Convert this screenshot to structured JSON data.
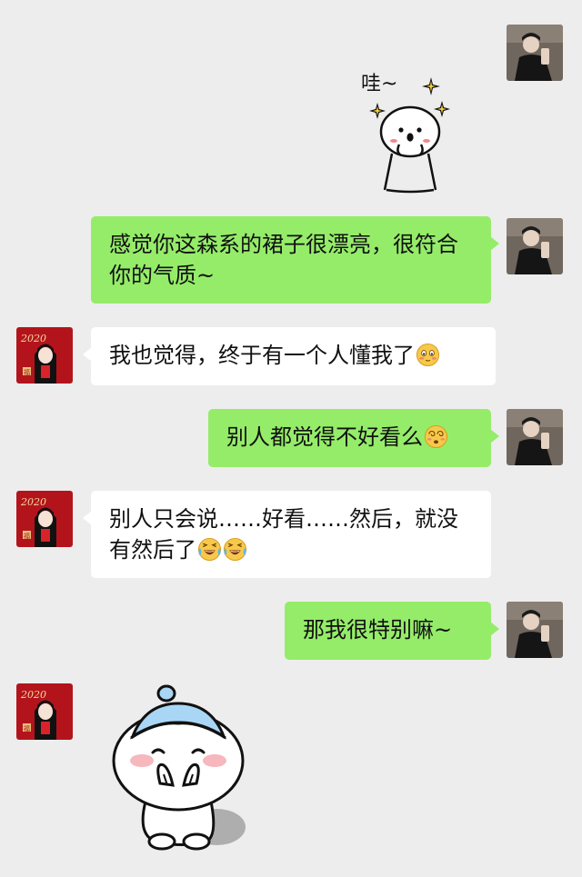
{
  "messages": [
    {
      "id": 1,
      "side": "me",
      "type": "sticker",
      "sticker_name": "wow-sticker",
      "text": "哇~"
    },
    {
      "id": 2,
      "side": "me",
      "type": "text",
      "text": "感觉你这森系的裙子很漂亮，很符合你的气质~"
    },
    {
      "id": 3,
      "side": "them",
      "type": "text",
      "text": "我也觉得，终于有一个人懂我了",
      "emojis": [
        "blush-emoji"
      ]
    },
    {
      "id": 4,
      "side": "me",
      "type": "text",
      "text": "别人都觉得不好看么",
      "emojis": [
        "dizzy-emoji"
      ]
    },
    {
      "id": 5,
      "side": "them",
      "type": "text",
      "text": "别人只会说……好看……然后，就没有然后了",
      "emojis": [
        "laugh-cry-emoji",
        "laugh-cry-emoji"
      ]
    },
    {
      "id": 6,
      "side": "me",
      "type": "text",
      "text": "那我很特别嘛~"
    },
    {
      "id": 7,
      "side": "them",
      "type": "sticker",
      "sticker_name": "shy-blob-sticker"
    }
  ],
  "them_avatar": {
    "caption": "2020",
    "badge": "福"
  },
  "colors": {
    "background": "#ededed",
    "my_bubble": "#95ec69",
    "their_bubble": "#ffffff",
    "their_avatar_red": "#b3141c"
  }
}
